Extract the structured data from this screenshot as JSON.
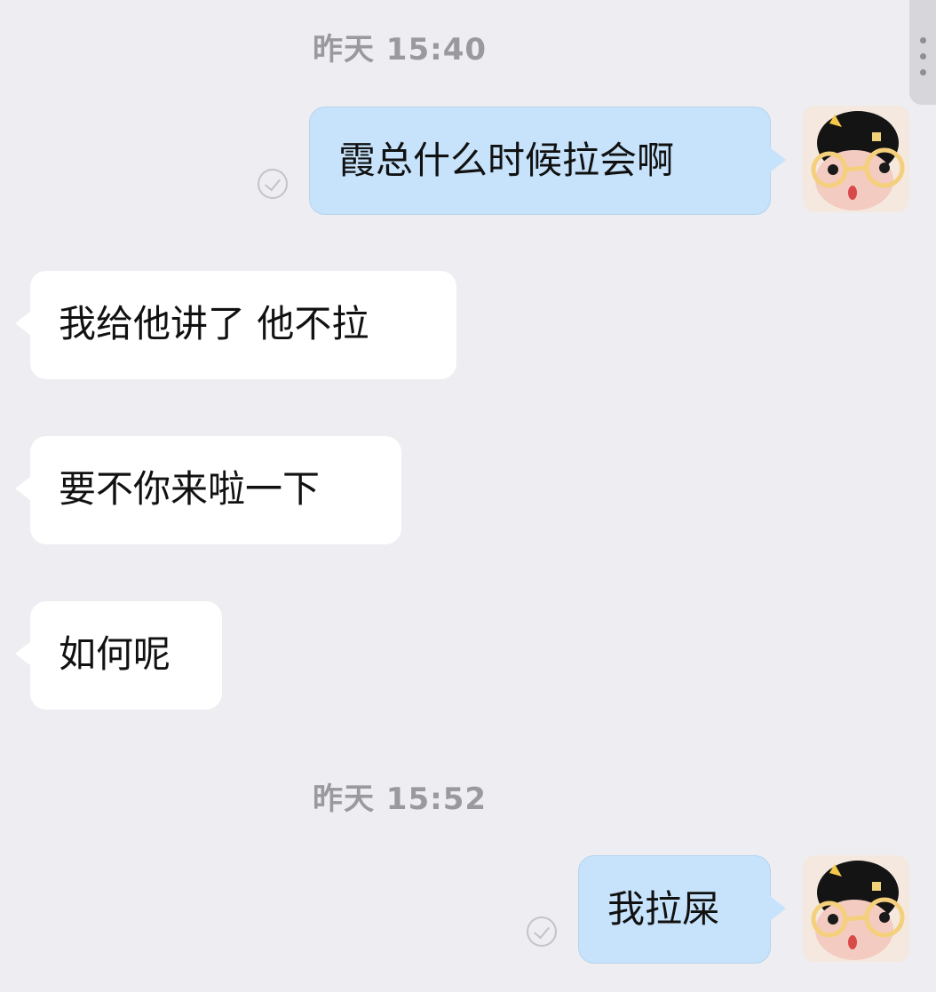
{
  "timestamps": [
    "昨天 15:40",
    "昨天 15:52"
  ],
  "messages": [
    {
      "direction": "out",
      "text": "霞总什么时候拉会啊",
      "status": "read-check-icon",
      "avatar": "plush-doll-with-glasses-avatar"
    },
    {
      "direction": "in",
      "text": "我给他讲了 他不拉"
    },
    {
      "direction": "in",
      "text": "要不你来啦一下"
    },
    {
      "direction": "in",
      "text": "如何呢"
    },
    {
      "direction": "out",
      "text": "我拉屎",
      "status": "read-check-icon",
      "avatar": "plush-doll-with-glasses-avatar"
    }
  ],
  "colors": {
    "background": "#EDEDF2",
    "outgoing_bubble": "#C6E3FB",
    "incoming_bubble": "#FFFFFF",
    "timestamp_text": "#9A9A9E"
  }
}
